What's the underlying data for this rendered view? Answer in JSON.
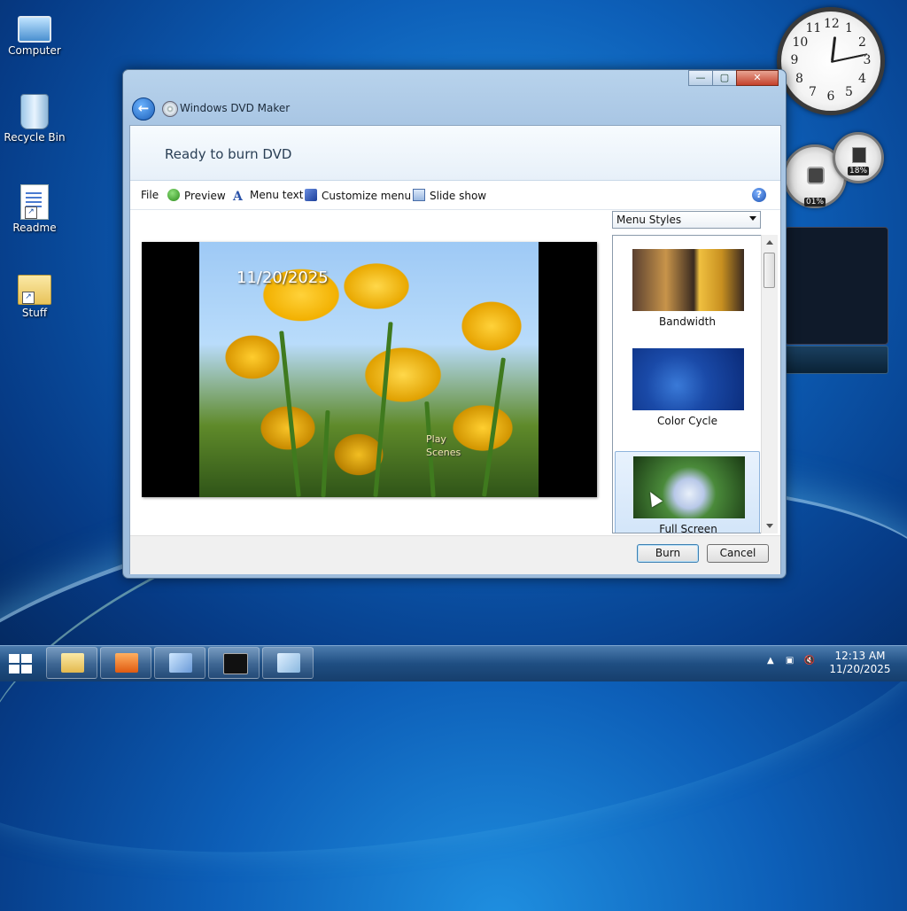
{
  "desktop": {
    "icons": [
      {
        "label": "Computer"
      },
      {
        "label": "Recycle Bin"
      },
      {
        "label": "Readme"
      },
      {
        "label": "Stuff"
      }
    ]
  },
  "gadgets": {
    "clock_numbers": [
      "12",
      "1",
      "2",
      "3",
      "4",
      "5",
      "6",
      "7",
      "8",
      "9",
      "10",
      "11"
    ],
    "cpu_meter": {
      "cpu": "01%",
      "memory": "18%"
    }
  },
  "window": {
    "title": "Windows DVD Maker",
    "header": "Ready to burn DVD",
    "controls": {
      "minimize": "—",
      "maximize": "▢",
      "close": "✕"
    },
    "menu": {
      "file": "File",
      "preview": "Preview",
      "menu_text": "Menu text",
      "customize_menu": "Customize menu",
      "slide_show": "Slide show"
    },
    "help": "?",
    "preview": {
      "date": "11/20/2025",
      "play": "Play",
      "scenes": "Scenes"
    },
    "styles": {
      "dropdown_value": "Menu Styles",
      "items": [
        {
          "label": "Bandwidth"
        },
        {
          "label": "Color Cycle"
        },
        {
          "label": "Full Screen"
        }
      ],
      "selected": "Full Screen"
    },
    "buttons": {
      "burn": "Burn",
      "cancel": "Cancel"
    }
  },
  "taskbar": {
    "time": "12:13 AM",
    "date": "11/20/2025",
    "colors": {
      "accent": "#1f4e82"
    }
  }
}
